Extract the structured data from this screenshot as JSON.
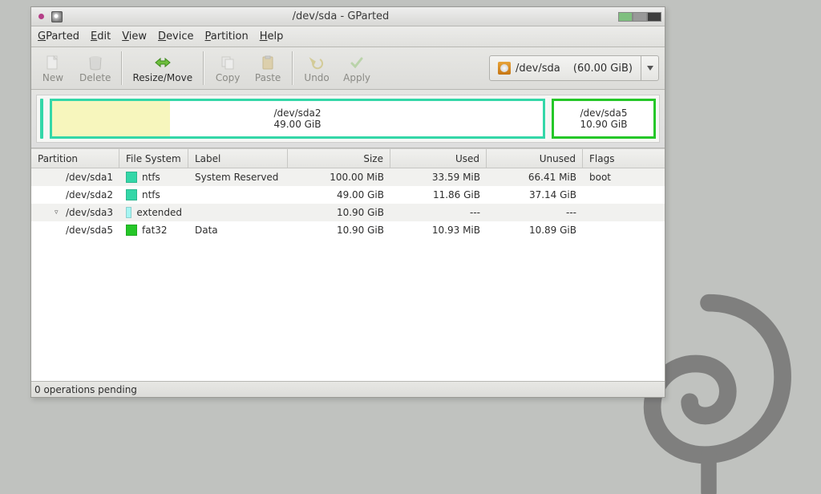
{
  "window": {
    "title": "/dev/sda - GParted"
  },
  "menubar": {
    "items": [
      "GParted",
      "Edit",
      "View",
      "Device",
      "Partition",
      "Help"
    ]
  },
  "toolbar": {
    "new": "New",
    "delete": "Delete",
    "resize": "Resize/Move",
    "copy": "Copy",
    "paste": "Paste",
    "undo": "Undo",
    "apply": "Apply"
  },
  "device": {
    "path": "/dev/sda",
    "capacity": "(60.00 GiB)"
  },
  "viz": {
    "main": {
      "name": "/dev/sda2",
      "size": "49.00 GiB"
    },
    "side": {
      "name": "/dev/sda5",
      "size": "10.90 GiB"
    }
  },
  "columns": {
    "partition": "Partition",
    "fs": "File System",
    "label": "Label",
    "size": "Size",
    "used": "Used",
    "unused": "Unused",
    "flags": "Flags"
  },
  "rows": [
    {
      "part": "/dev/sda1",
      "fs": "ntfs",
      "swatch": "sw-ntfs",
      "label": "System Reserved",
      "size": "100.00 MiB",
      "used": "33.59 MiB",
      "unused": "66.41 MiB",
      "flags": "boot",
      "indent": 0
    },
    {
      "part": "/dev/sda2",
      "fs": "ntfs",
      "swatch": "sw-ntfs",
      "label": "",
      "size": "49.00 GiB",
      "used": "11.86 GiB",
      "unused": "37.14 GiB",
      "flags": "",
      "indent": 0
    },
    {
      "part": "/dev/sda3",
      "fs": "extended",
      "swatch": "sw-ext",
      "label": "",
      "size": "10.90 GiB",
      "used": "---",
      "unused": "---",
      "flags": "",
      "indent": 0,
      "expander": "▿"
    },
    {
      "part": "/dev/sda5",
      "fs": "fat32",
      "swatch": "sw-fat",
      "label": "Data",
      "size": "10.90 GiB",
      "used": "10.93 MiB",
      "unused": "10.89 GiB",
      "flags": "",
      "indent": 1
    }
  ],
  "status": "0 operations pending"
}
